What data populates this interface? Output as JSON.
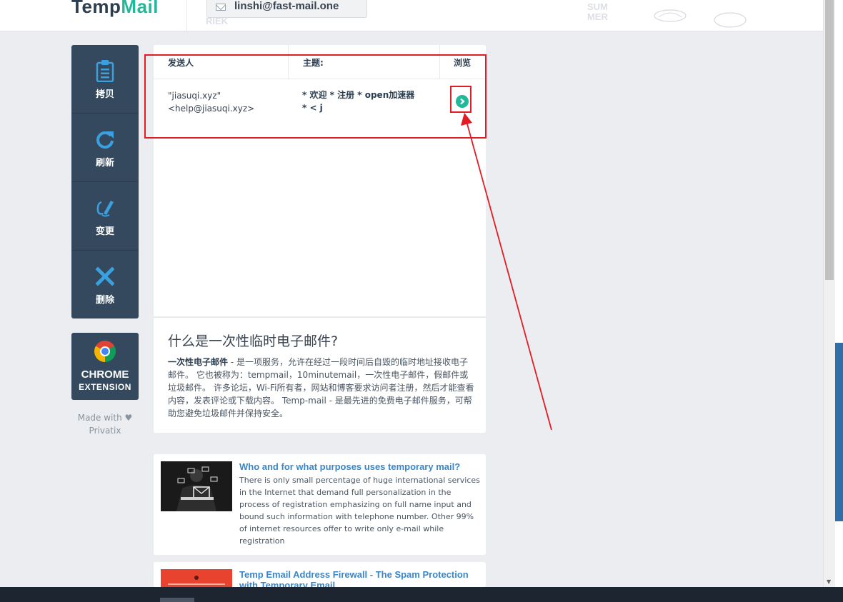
{
  "header": {
    "logo_part1": "Temp",
    "logo_part2": "Mail",
    "email": "linshi@fast-mail.one",
    "decor_text_1": "RIEK",
    "decor_text_2": "SUM",
    "decor_text_3": "MER"
  },
  "sidebar": {
    "items": [
      {
        "label": "拷贝",
        "icon": "clipboard-icon"
      },
      {
        "label": "刷新",
        "icon": "refresh-icon"
      },
      {
        "label": "变更",
        "icon": "edit-icon"
      },
      {
        "label": "删除",
        "icon": "delete-icon"
      }
    ],
    "chrome_line1": "CHROME",
    "chrome_line2": "EXTENSION",
    "made_with": "Made with ♥",
    "made_by": "Privatix"
  },
  "inbox": {
    "col_sender": "发送人",
    "col_subject": "主题:",
    "col_view": "浏览",
    "messages": [
      {
        "sender_name": "\"jiasuqi.xyz\"",
        "sender_email": "<help@jiasuqi.xyz>",
        "subject_line1": "* 欢迎 * 注册 * open加速器",
        "subject_line2": "* < j"
      }
    ]
  },
  "info": {
    "title": "什么是一次性临时电子邮件?",
    "bold_term": "一次性电子邮件",
    "body": " - 是一项服务，允许在经过一段时间后自毁的临时地址接收电子邮件。 它也被称为：tempmail，10minutemail，一次性电子邮件，假邮件或垃圾邮件。 许多论坛，Wi-Fi所有者，网站和博客要求访问者注册，然后才能查看内容，发表评论或下载内容。 Temp-mail - 是最先进的免费电子邮件服务，可帮助您避免垃圾邮件并保持安全。"
  },
  "articles": [
    {
      "title": "Who and for what purposes uses temporary mail?",
      "text": "There is only small percentage of huge international services in the Internet that demand full personalization in the process of registration emphasizing on full name input and bound such information with telephone number. Other 99% of internet resources offer to write only e-mail while registration"
    },
    {
      "title": "Temp Email Address Firewall - The Spam Protection with Temporary Email",
      "text": ""
    }
  ],
  "colors": {
    "sidebar_bg": "#34495e",
    "accent": "#22b89a",
    "link": "#3a86c8",
    "annotation": "#e31b23"
  }
}
